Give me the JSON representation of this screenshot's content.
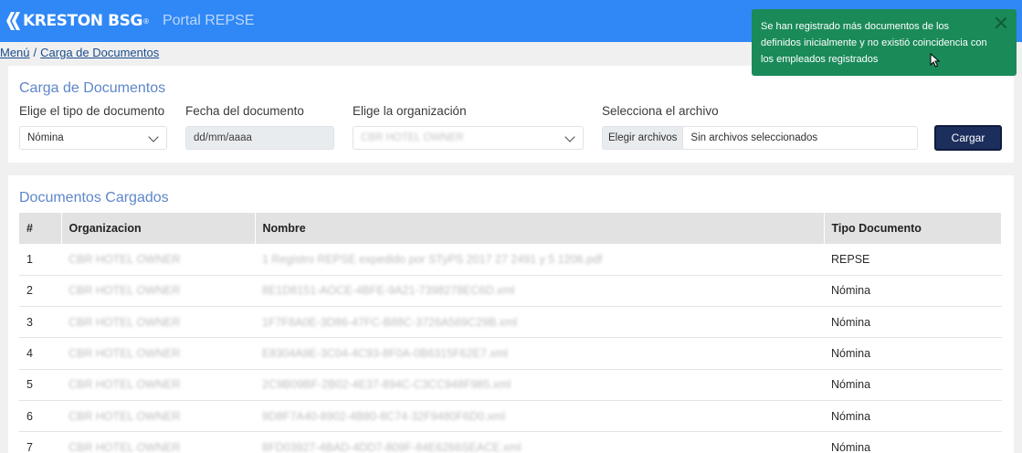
{
  "header": {
    "logo_text": "KRESTON BSG",
    "logo_reg": "®",
    "portal_title": "Portal REPSE",
    "bg_color": "#2f88f5"
  },
  "breadcrumb": {
    "menu": "Menú",
    "separator": "/",
    "current": "Carga de Documentos"
  },
  "upload": {
    "title": "Carga de Documentos",
    "doc_type_label": "Elige el tipo de documento",
    "doc_type_value": "Nómina",
    "date_label": "Fecha del documento",
    "date_placeholder": "dd/mm/aaaa",
    "org_label": "Elige la organización",
    "org_value": "CBR HOTEL OWNER",
    "file_label": "Selecciona el archivo",
    "file_button": "Elegir archivos",
    "file_status": "Sin archivos seleccionados",
    "submit_label": "Cargar"
  },
  "documents": {
    "title": "Documentos Cargados",
    "columns": [
      "#",
      "Organizacion",
      "Nombre",
      "Tipo Documento"
    ],
    "rows": [
      {
        "n": "1",
        "org": "CBR HOTEL OWNER",
        "name": "1 Registro REPSE expedido por STyPS 2017 27 2491 y 5 1206.pdf",
        "type": "REPSE"
      },
      {
        "n": "2",
        "org": "CBR HOTEL OWNER",
        "name": "8E1D8151-AOCE-4BFE-9A21-7398278EC6D.xml",
        "type": "Nómina"
      },
      {
        "n": "3",
        "org": "CBR HOTEL OWNER",
        "name": "1F7F8A0E-3D86-47FC-B88C-3726A569C29B.xml",
        "type": "Nómina"
      },
      {
        "n": "4",
        "org": "CBR HOTEL OWNER",
        "name": "E8304A9E-3C04-4C93-8F0A-0B6315F62E7.xml",
        "type": "Nómina"
      },
      {
        "n": "5",
        "org": "CBR HOTEL OWNER",
        "name": "2C9B09BF-2B02-4E37-894C-C3CC948F985.xml",
        "type": "Nómina"
      },
      {
        "n": "6",
        "org": "CBR HOTEL OWNER",
        "name": "9D8F7A40-8902-4B80-8C74-32F9480F6D0.xml",
        "type": "Nómina"
      },
      {
        "n": "7",
        "org": "CBR HOTEL OWNER",
        "name": "8FD03927-4BAD-4DD7-809F-84E6266SEACE.xml",
        "type": "Nómina"
      }
    ]
  },
  "toast": {
    "message": "Se han registrado más documentos de los definidos inicialmente y no existió coincidencia con los empleados registrados",
    "bg_color": "#1a8a59"
  }
}
